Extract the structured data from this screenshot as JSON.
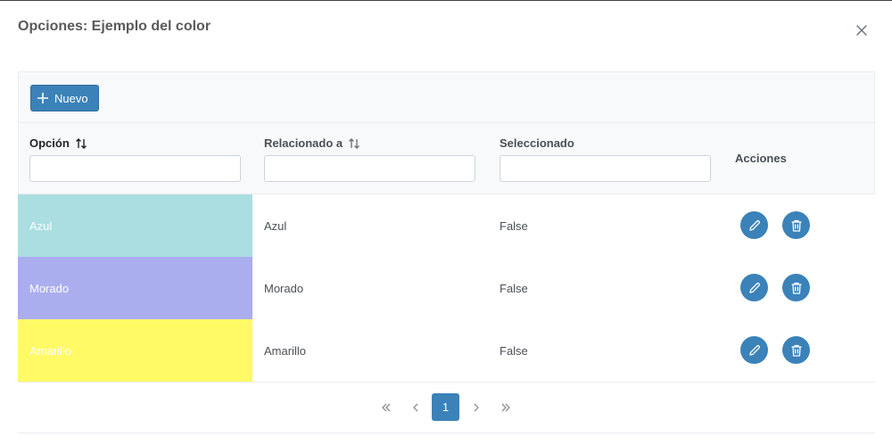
{
  "dialog": {
    "title": "Opciones: Ejemplo del color",
    "close_icon": "close-icon"
  },
  "toolbar": {
    "new_label": "Nuevo",
    "new_icon": "plus-icon"
  },
  "table": {
    "columns": [
      {
        "label": "Opción",
        "sortable": true,
        "filter_value": "",
        "active": true
      },
      {
        "label": "Relacionado a",
        "sortable": true,
        "filter_value": ""
      },
      {
        "label": "Seleccionado",
        "sortable": false,
        "filter_value": ""
      },
      {
        "label": "Acciones",
        "sortable": false
      }
    ],
    "rows": [
      {
        "option": "Azul",
        "color": "#aadee1",
        "related": "Azul",
        "selected": "False"
      },
      {
        "option": "Morado",
        "color": "#aaaeee",
        "related": "Morado",
        "selected": "False"
      },
      {
        "option": "Amarillo",
        "color": "#fffa65",
        "related": "Amarillo",
        "selected": "False"
      }
    ],
    "action_icons": [
      "pencil-icon",
      "trash-icon"
    ]
  },
  "pagination": {
    "current_page": "1",
    "icons": [
      "first-page-icon",
      "prev-page-icon",
      "next-page-icon",
      "last-page-icon"
    ]
  },
  "colors": {
    "primary": "#3b82b9",
    "header_bg": "#f8f9fa",
    "border": "#e9ecef"
  }
}
